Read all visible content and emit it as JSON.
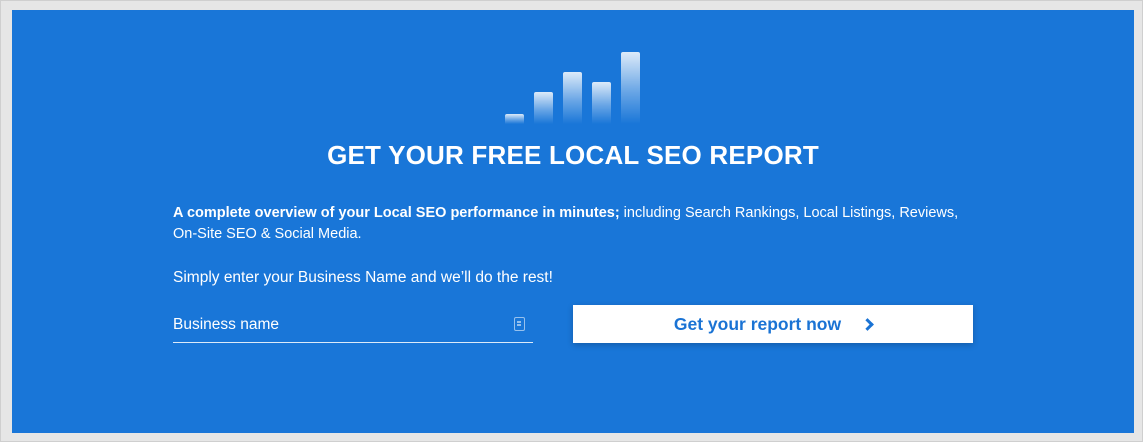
{
  "hero": {
    "title": "GET YOUR FREE LOCAL SEO REPORT",
    "intro_bold": "A complete overview of your Local SEO performance in minutes;",
    "intro_rest": " including Search Rankings, Local Listings, Reviews, On-Site SEO & Social Media.",
    "cta_text": "Simply enter your Business Name and we’ll do the rest!"
  },
  "form": {
    "business_name": {
      "placeholder": "Business name",
      "value": ""
    },
    "submit_label": "Get your report now"
  },
  "icons": {
    "bars": "bar-chart-icon",
    "field": "contact-card-icon",
    "button": "chevron-right-icon"
  },
  "colors": {
    "panel": "#1976d8",
    "button_text": "#1a73d4",
    "text": "#ffffff"
  }
}
